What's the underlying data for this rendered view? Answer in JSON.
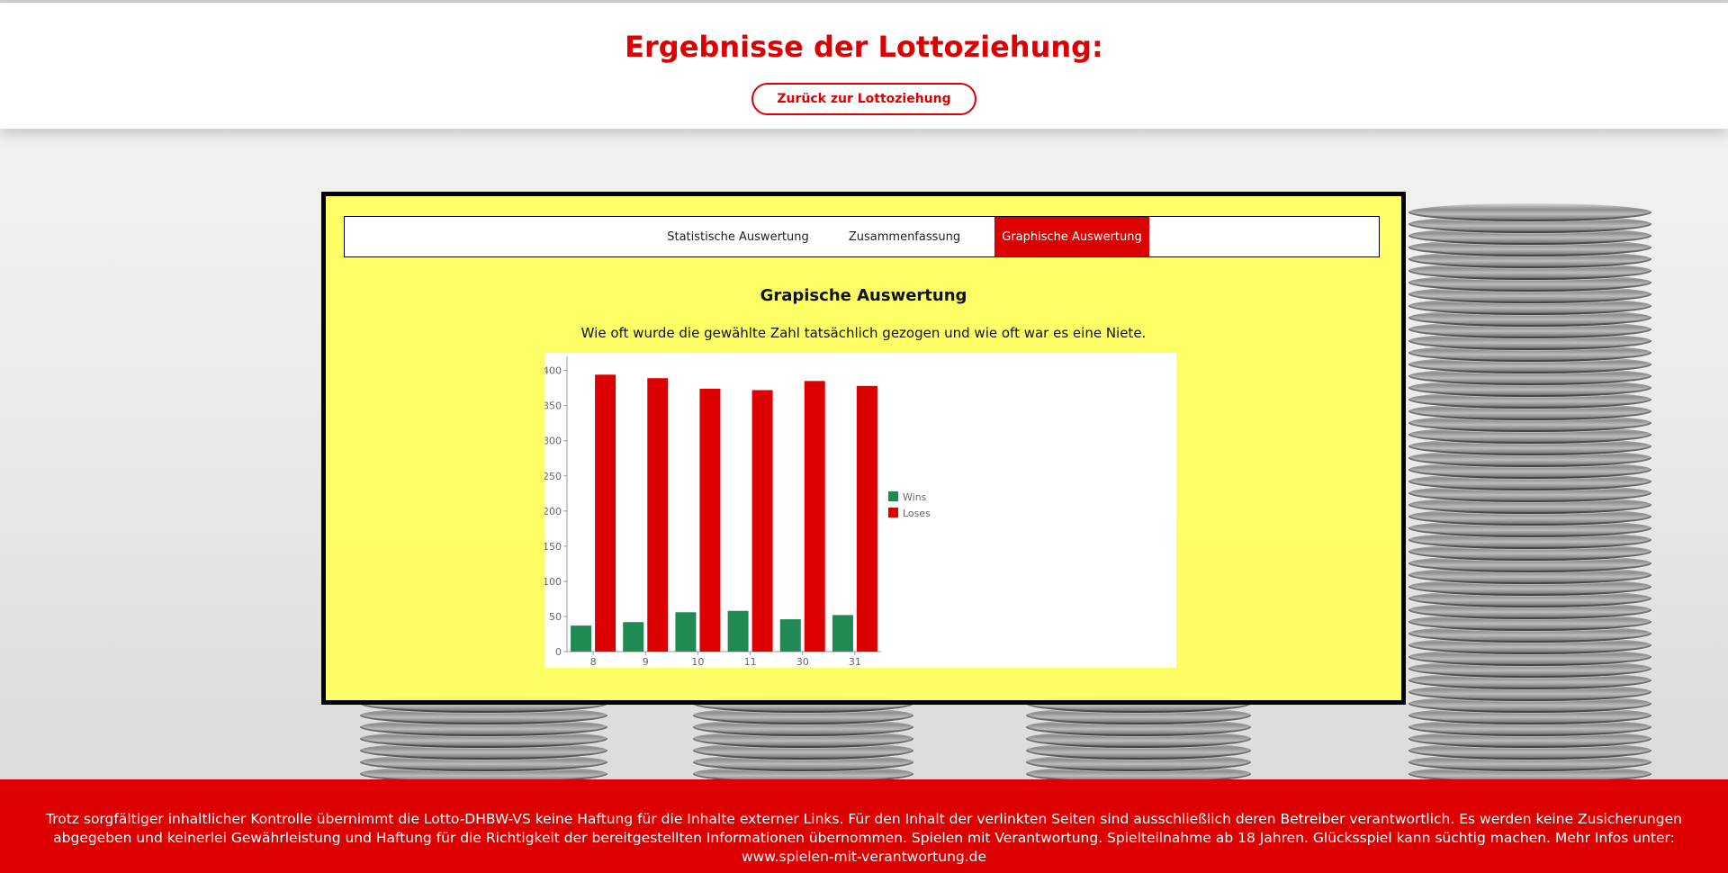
{
  "header": {
    "title": "Ergebnisse der Lottoziehung:",
    "back_button_label": "Zurück zur Lottoziehung"
  },
  "tabs": [
    {
      "label": "Statistische Auswertung",
      "active": false
    },
    {
      "label": "Zusammenfassung",
      "active": false
    },
    {
      "label": "Graphische Auswertung",
      "active": true
    }
  ],
  "section": {
    "title": "Grapische Auswertung",
    "description": "Wie oft wurde die gewählte Zahl tatsächlich gezogen und wie oft war es eine Niete."
  },
  "chart_data": {
    "type": "bar",
    "categories": [
      "8",
      "9",
      "10",
      "11",
      "30",
      "31"
    ],
    "series": [
      {
        "name": "Wins",
        "color": "#208a55",
        "values": [
          37,
          42,
          56,
          58,
          46,
          52
        ]
      },
      {
        "name": "Loses",
        "color": "#dd0000",
        "values": [
          394,
          389,
          374,
          372,
          385,
          378
        ]
      }
    ],
    "ylim": [
      0,
      420
    ],
    "yticks": [
      0,
      50,
      100,
      150,
      200,
      250,
      300,
      350,
      400
    ],
    "legend": "right",
    "grid": false
  },
  "footer": {
    "text": "Trotz sorgfältiger inhaltlicher Kontrolle übernimmt die Lotto-DHBW-VS keine Haftung für die Inhalte externer Links. Für den Inhalt der verlinkten Seiten sind ausschließlich deren Betreiber verantwortlich. Es werden keine Zusicherungen abgegeben und keinerlei Gewährleistung und Haftung für die Richtigkeit der bereitgestellten Informationen übernommen. Spielen mit Verantwortung. Spielteilnahme ab 18 Jahren. Glücksspiel kann süchtig machen. Mehr Infos unter: www.spielen-mit-verantwortung.de"
  }
}
